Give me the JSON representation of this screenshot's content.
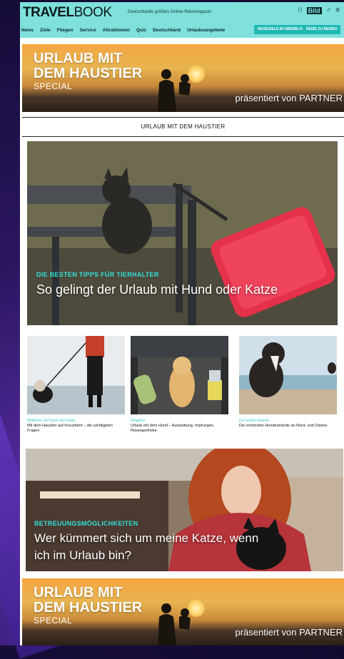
{
  "header": {
    "logo_bold": "TRAVEL",
    "logo_light": "BOOK",
    "tagline": "Deutschlands größtes Online-Reisemagazin",
    "icons": [
      "grid-icon",
      "bild-logo",
      "user-icon",
      "menu-icon"
    ],
    "bild_label": "Bild",
    "nav": [
      "News",
      "Ziele",
      "Fliegen",
      "Service",
      "Attraktionen",
      "Quiz",
      "Deutschland",
      "Urlaubsangebote"
    ],
    "button_overview": "REISEZIELE IM ÜBERBLICK",
    "button_deals": "REISE ZU REISEN"
  },
  "banner": {
    "line1": "URLAUB MIT",
    "line2": "DEM HAUSTIER",
    "special": "SPECIAL",
    "partner": "präsentiert von PARTNER"
  },
  "section_title": "URLAUB MIT DEM HAUSTIER",
  "hero": {
    "kicker": "DIE BESTEN TIPPS FÜR TIERHALTER",
    "title": "So gelingt der Urlaub mit Hund oder Katze"
  },
  "cards": [
    {
      "kicker": "Mitfahren mit Hund oder Katze",
      "text": "Mit dem Haustier auf Kreuzfahrt – die wichtigsten Fragen"
    },
    {
      "kicker": "Ratgeber",
      "text": "Urlaub mit dem Hund – Ausstattung, Impfungen, Reiseapotheke"
    },
    {
      "kicker": "Die besten Anlaufe",
      "text": "Die schönsten Hundestrände an Nord- und Ostsee"
    }
  ],
  "cat_article": {
    "kicker": "BETREUUNGSMÖGLICHKEITEN",
    "title": "Wer kümmert sich um meine Katze, wenn ich im Urlaub bin?"
  },
  "colors": {
    "accent": "#7fe0dc",
    "kicker": "#33e0d8",
    "button": "#1fb8b4"
  }
}
